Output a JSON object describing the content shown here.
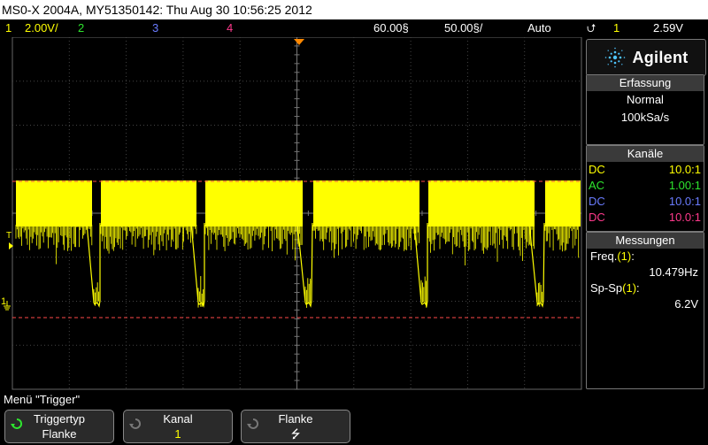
{
  "title": "MS0-X 2004A, MY51350142: Thu Aug 30 10:56:25 2012",
  "status": {
    "ch1_num": "1",
    "ch1_scale": "2.00V/",
    "ch2_num": "2",
    "ch3_num": "3",
    "ch4_num": "4",
    "time_pos": "60.00§",
    "time_scale": "50.00§/",
    "trigger_mode": "Auto",
    "trigger_channel": "1",
    "trigger_level": "2.59V"
  },
  "logo": {
    "text": "Agilent"
  },
  "erfassung": {
    "header": "Erfassung",
    "mode": "Normal",
    "rate": "100kSa/s"
  },
  "kanaele": {
    "header": "Kanäle",
    "rows": [
      {
        "coupling": "DC",
        "probe": "10.0:1",
        "color": "#ffff00"
      },
      {
        "coupling": "AC",
        "probe": "1.00:1",
        "color": "#2ee52e"
      },
      {
        "coupling": "DC",
        "probe": "10.0:1",
        "color": "#6a7cff"
      },
      {
        "coupling": "DC",
        "probe": "10.0:1",
        "color": "#ff3a8c"
      }
    ]
  },
  "messungen": {
    "header": "Messungen",
    "freq_label": "Freq.",
    "freq_ch": "(1)",
    "freq_value": "10.479Hz",
    "pp_label": "Sp-Sp",
    "pp_ch": "(1)",
    "pp_value": "6.2V"
  },
  "grid_markers": {
    "trigger_marker": "T",
    "ground_marker": "1"
  },
  "menu": {
    "title": "Menü \"Trigger\"",
    "softkeys": [
      {
        "label": "Triggertyp",
        "value": "Flanke"
      },
      {
        "label": "Kanal",
        "value": "1"
      },
      {
        "label": "Flanke",
        "value": "⭍"
      }
    ]
  },
  "colors": {
    "channel1": "#ffff00",
    "grid": "#444444",
    "trigger_level_line": "#ff4a4a",
    "timebase_marker": "#ff8800"
  }
}
